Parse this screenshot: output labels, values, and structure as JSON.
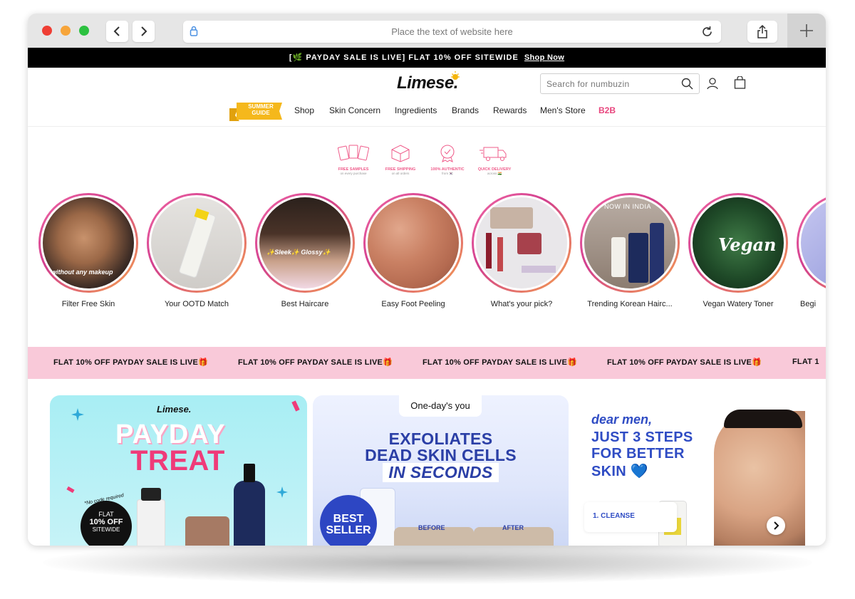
{
  "browser": {
    "address_placeholder": "Place the text of website here"
  },
  "promo_bar": {
    "text": "[🌿 PAYDAY SALE IS LIVE] FLAT 10% OFF SITEWIDE",
    "link": "Shop Now"
  },
  "header": {
    "logo": "Limese.",
    "search_placeholder": "Search for numbuzin"
  },
  "nav": {
    "summer_guide": "SUMMER GUIDE",
    "items": [
      "Shop",
      "Skin Concern",
      "Ingredients",
      "Brands",
      "Rewards",
      "Men's Store",
      "B2B"
    ]
  },
  "features": [
    {
      "label": "FREE SAMPLES",
      "sub": "on every purchase",
      "icon": "samples-icon"
    },
    {
      "label": "FREE SHIPPING",
      "sub": "on all orders",
      "icon": "shipping-icon"
    },
    {
      "label": "100% AUTHENTIC",
      "sub": "from 🇰🇷",
      "icon": "authentic-icon"
    },
    {
      "label": "QUICK DELIVERY",
      "sub": "across 🇮🇳",
      "icon": "delivery-icon"
    }
  ],
  "stories": [
    {
      "caption": "Filter Free Skin",
      "overlay": "without any makeup"
    },
    {
      "caption": "Your OOTD Match",
      "overlay": ""
    },
    {
      "caption": "Best Haircare",
      "overlay": "✨Sleek✨   Glossy✨"
    },
    {
      "caption": "Easy Foot Peeling",
      "overlay": ""
    },
    {
      "caption": "What's your pick?",
      "overlay": ""
    },
    {
      "caption": "Trending Korean Hairc...",
      "overlay": "NOW IN INDIA"
    },
    {
      "caption": "Vegan Watery Toner",
      "overlay": "Vegan"
    },
    {
      "caption": "Begi",
      "overlay": ""
    }
  ],
  "marquee": {
    "text": "FLAT 10% OFF PAYDAY SALE IS LIVE🎁",
    "tail": "FLAT 1"
  },
  "banner1": {
    "brand": "Limese.",
    "title1": "PAYDAY",
    "title2": "TREAT",
    "code_note": "*No code required",
    "disc_a": "FLAT",
    "disc_b": "10% OFF",
    "disc_c": "SITEWIDE"
  },
  "banner2": {
    "tag": "One-day's you",
    "line1": "EXFOLIATES",
    "line2": "DEAD SKIN CELLS",
    "line3": "IN SECONDS",
    "badge1": "BEST",
    "badge2": "SELLER",
    "before": "BEFORE",
    "after": "AFTER"
  },
  "banner3": {
    "greeting": "dear men,",
    "line1": "JUST 3 STEPS",
    "line2": "FOR BETTER",
    "line3": "SKIN 💙",
    "step": "1. CLEANSE"
  },
  "colors": {
    "accent_pink": "#e8457d",
    "brand_blue": "#2f4cc4",
    "marquee_bg": "#f9c9d9"
  }
}
